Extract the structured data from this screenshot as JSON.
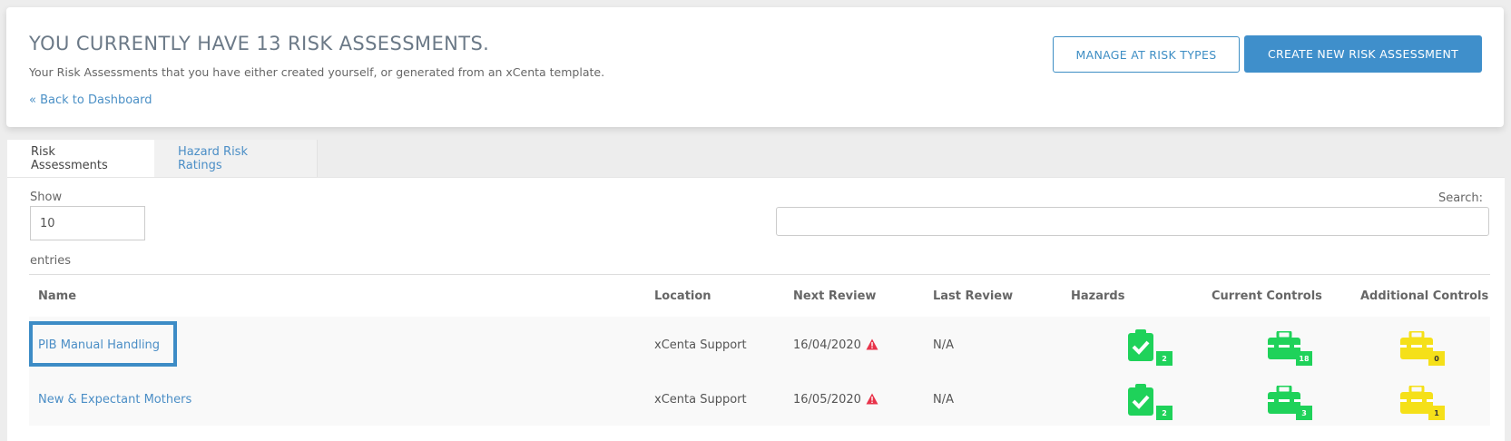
{
  "header": {
    "title": "YOU CURRENTLY HAVE 13 RISK ASSESSMENTS.",
    "subtitle": "Your Risk Assessments that you have either created yourself, or generated from an xCenta template.",
    "back_link": "« Back to Dashboard",
    "manage_button": "MANAGE AT RISK TYPES",
    "create_button": "CREATE NEW RISK ASSESSMENT"
  },
  "tabs": [
    {
      "label": "Risk Assessments",
      "active": true
    },
    {
      "label": "Hazard Risk Ratings",
      "active": false
    }
  ],
  "controls": {
    "show_label": "Show",
    "show_value": "10",
    "entries_label": "entries",
    "search_label": "Search:",
    "search_value": ""
  },
  "table": {
    "columns": [
      "Name",
      "Location",
      "Next Review",
      "Last Review",
      "Hazards",
      "Current Controls",
      "Additional Controls"
    ],
    "rows": [
      {
        "name": "PIB Manual Handling",
        "location": "xCenta Support",
        "next_review": "16/04/2020",
        "last_review": "N/A",
        "hazards": "2",
        "current_controls": "18",
        "additional_controls": "0"
      },
      {
        "name": "New & Expectant Mothers",
        "location": "xCenta Support",
        "next_review": "16/05/2020",
        "last_review": "N/A",
        "hazards": "2",
        "current_controls": "3",
        "additional_controls": "1"
      }
    ]
  },
  "colors": {
    "accent": "#3f8fcb",
    "green": "#1fd25a",
    "yellow": "#f5e019",
    "warning": "#e8334a"
  },
  "icons": {
    "hazards": "clipboard-check-icon",
    "current_controls": "toolbox-icon",
    "additional_controls": "toolbox-icon",
    "overdue": "warning-triangle-icon"
  }
}
